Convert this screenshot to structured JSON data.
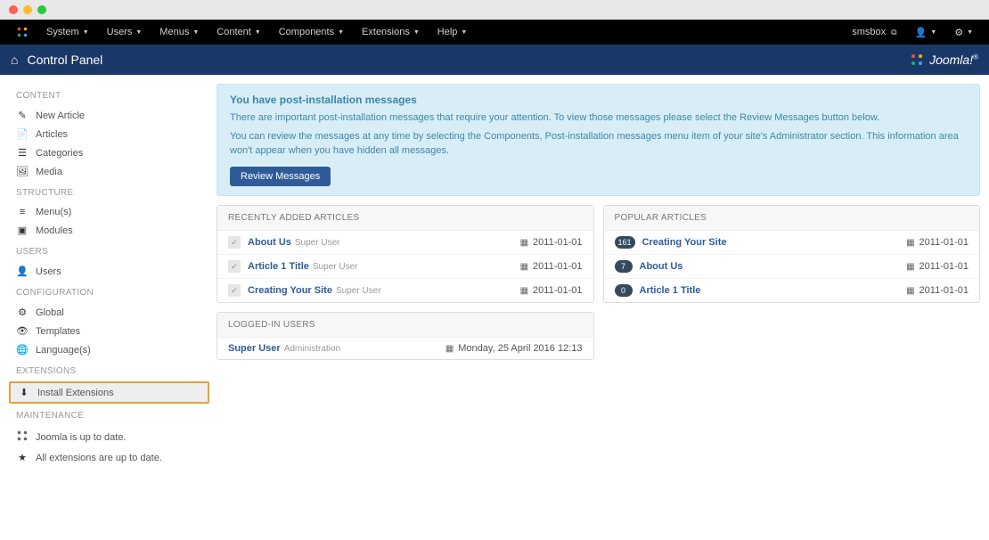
{
  "nav": {
    "items": [
      "System",
      "Users",
      "Menus",
      "Content",
      "Components",
      "Extensions",
      "Help"
    ],
    "right_label": "smsbox"
  },
  "header": {
    "title": "Control Panel",
    "brand": "Joomla!"
  },
  "sidebar": {
    "content": {
      "title": "CONTENT",
      "items": [
        {
          "icon": "✎",
          "label": "New Article"
        },
        {
          "icon": "📄",
          "label": "Articles"
        },
        {
          "icon": "☰",
          "label": "Categories"
        },
        {
          "icon": "🖼",
          "label": "Media"
        }
      ]
    },
    "structure": {
      "title": "STRUCTURE",
      "items": [
        {
          "icon": "≡",
          "label": "Menu(s)"
        },
        {
          "icon": "▣",
          "label": "Modules"
        }
      ]
    },
    "users": {
      "title": "USERS",
      "items": [
        {
          "icon": "👤",
          "label": "Users"
        }
      ]
    },
    "configuration": {
      "title": "CONFIGURATION",
      "items": [
        {
          "icon": "⚙",
          "label": "Global"
        },
        {
          "icon": "👁",
          "label": "Templates"
        },
        {
          "icon": "🌐",
          "label": "Language(s)"
        }
      ]
    },
    "extensions": {
      "title": "EXTENSIONS",
      "items": [
        {
          "icon": "⬇",
          "label": "Install Extensions",
          "highlighted": true
        }
      ]
    },
    "maintenance": {
      "title": "MAINTENANCE",
      "items": [
        {
          "label": "Joomla is up to date."
        },
        {
          "label": "All extensions are up to date."
        }
      ]
    }
  },
  "alert": {
    "title": "You have post-installation messages",
    "line1": "There are important post-installation messages that require your attention. To view those messages please select the Review Messages button below.",
    "line2": "You can review the messages at any time by selecting the Components, Post-installation messages menu item of your site's Administrator section. This information area won't appear when you have hidden all messages.",
    "button": "Review Messages"
  },
  "recent": {
    "title": "RECENTLY ADDED ARTICLES",
    "rows": [
      {
        "title": "About Us",
        "author": "Super User",
        "date": "2011-01-01"
      },
      {
        "title": "Article 1 Title",
        "author": "Super User",
        "date": "2011-01-01"
      },
      {
        "title": "Creating Your Site",
        "author": "Super User",
        "date": "2011-01-01"
      }
    ]
  },
  "popular": {
    "title": "POPULAR ARTICLES",
    "rows": [
      {
        "count": "161",
        "title": "Creating Your Site",
        "date": "2011-01-01"
      },
      {
        "count": "7",
        "title": "About Us",
        "date": "2011-01-01"
      },
      {
        "count": "0",
        "title": "Article 1 Title",
        "date": "2011-01-01"
      }
    ]
  },
  "logged_in": {
    "title": "LOGGED-IN USERS",
    "rows": [
      {
        "user": "Super User",
        "role": "Administration",
        "time": "Monday, 25 April 2016 12:13"
      }
    ]
  }
}
